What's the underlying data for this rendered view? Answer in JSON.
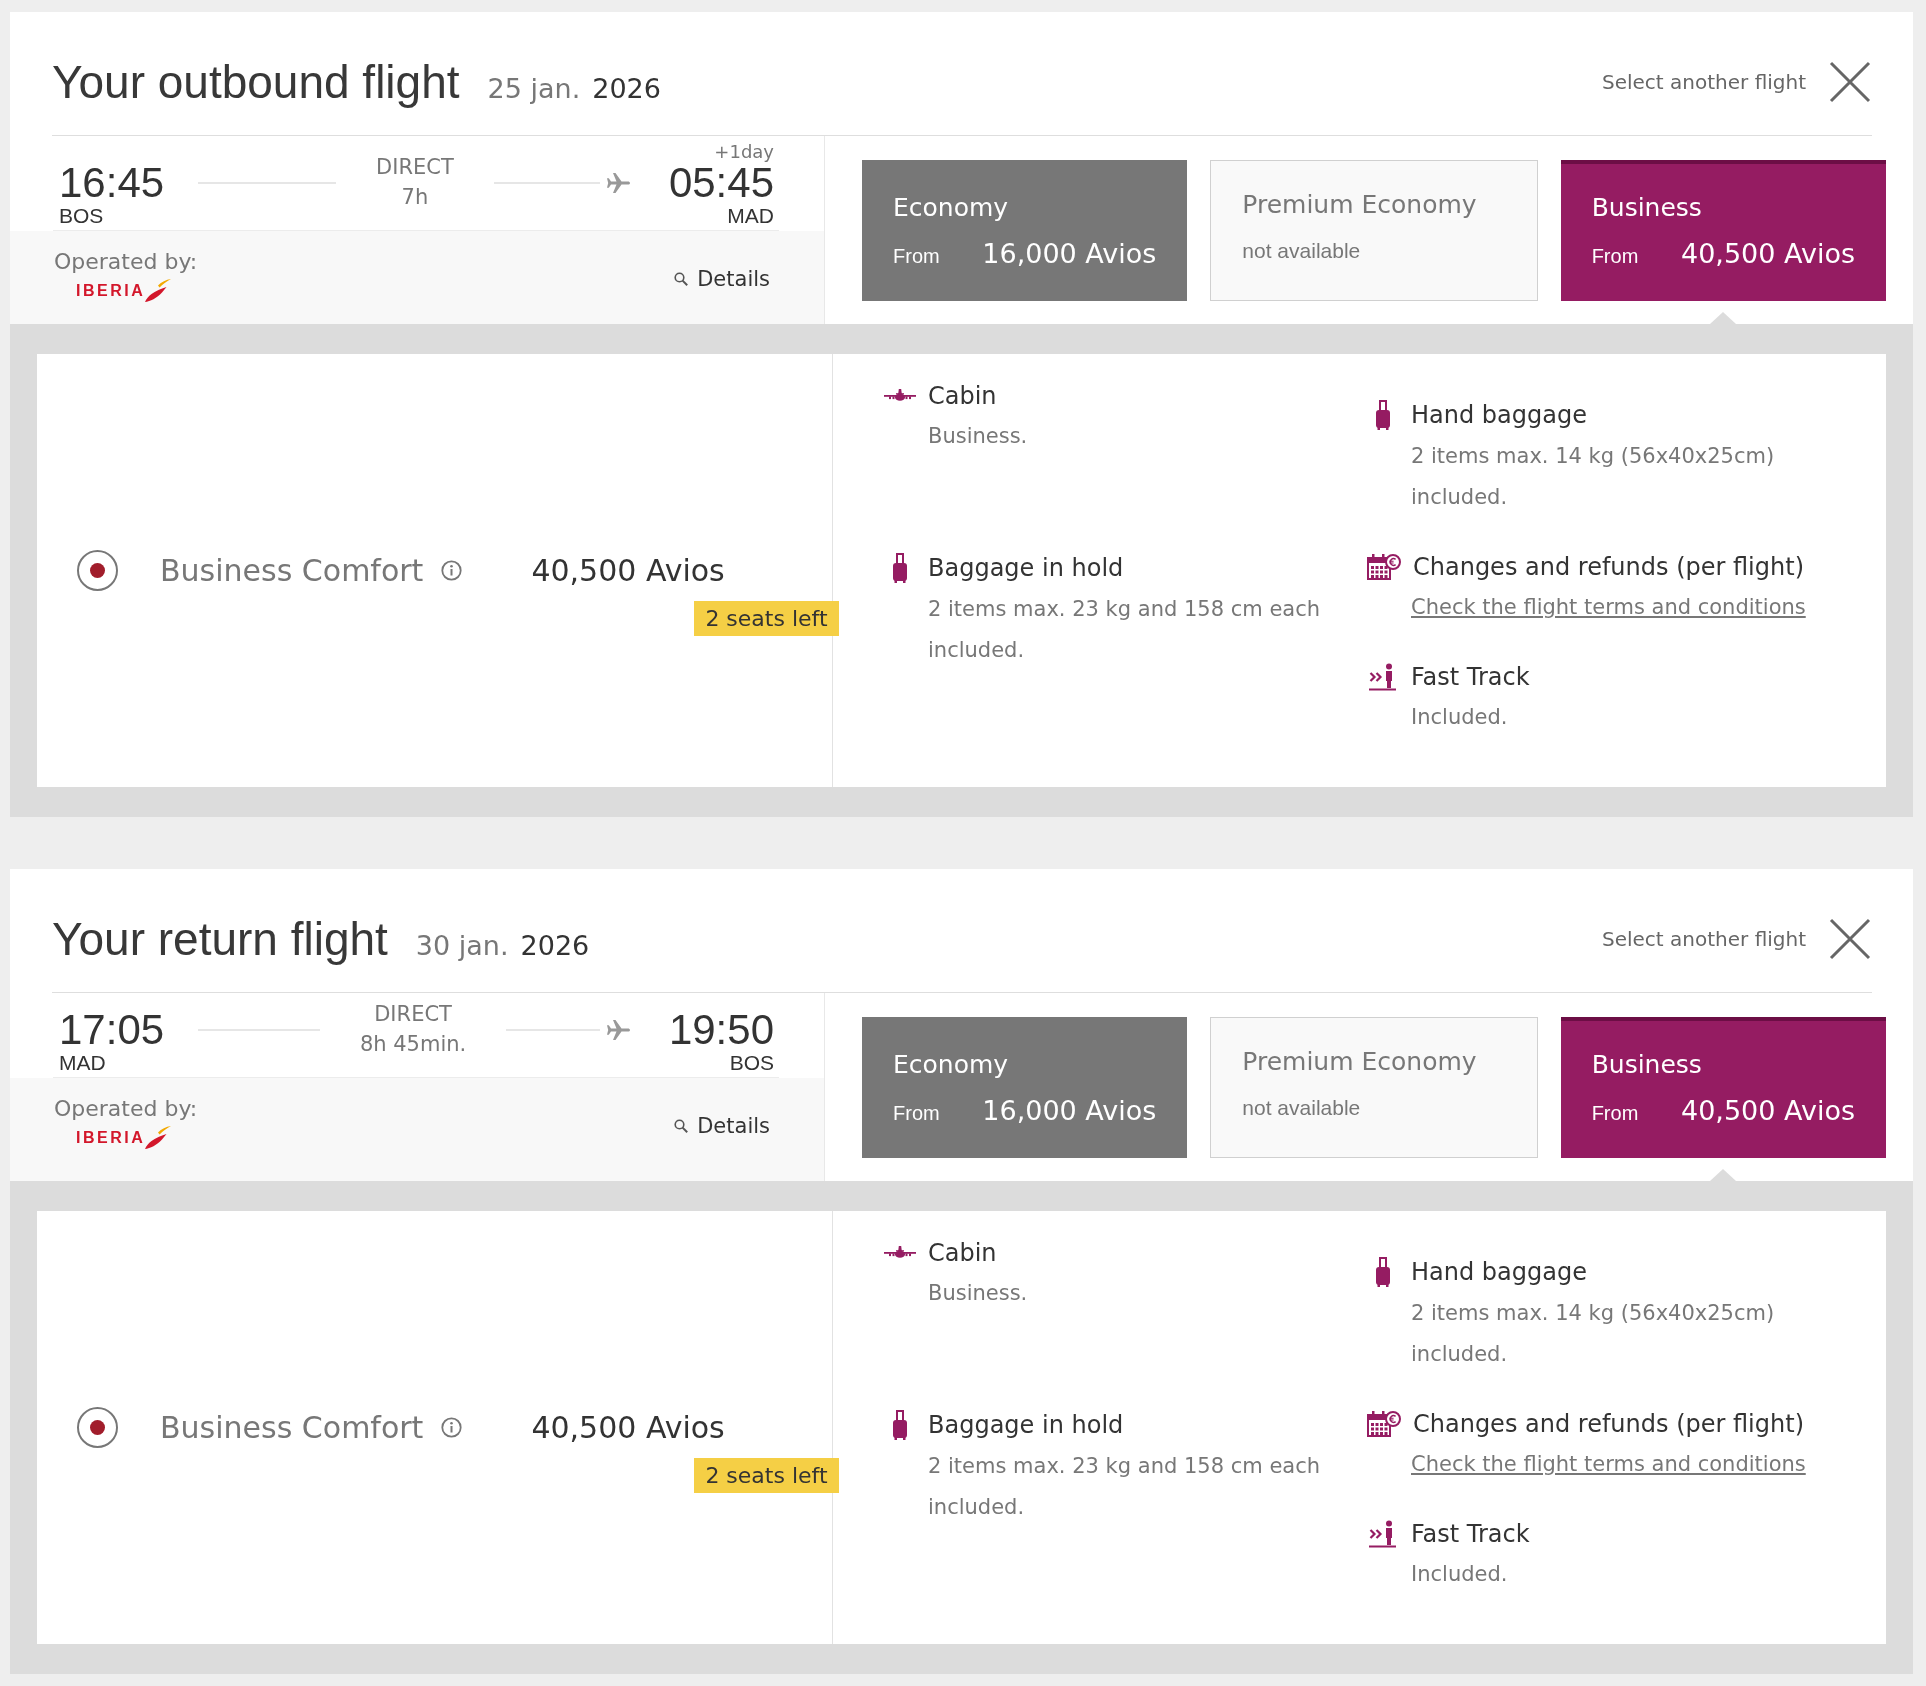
{
  "flights": [
    {
      "heading": "Your outbound flight",
      "date": "25 jan.",
      "year": "2026",
      "change_link": "Select another flight",
      "departure": {
        "time": "16:45",
        "airport": "BOS"
      },
      "stops": "DIRECT",
      "duration": "7h",
      "arrival": {
        "day_offset": "+1day",
        "time": "05:45",
        "airport": "MAD"
      },
      "operated_by": "Operated by:",
      "airline": "IBERIA",
      "details_link": "Details",
      "fares": [
        {
          "cabin": "Economy",
          "available": true,
          "selected": false,
          "from_label": "From",
          "price": "16,000 Avios"
        },
        {
          "cabin": "Premium Economy",
          "available": false,
          "selected": false,
          "note": "not available"
        },
        {
          "cabin": "Business",
          "available": true,
          "selected": true,
          "from_label": "From",
          "price": "40,500 Avios"
        }
      ],
      "options": [
        {
          "name": "Business Comfort",
          "selected": true,
          "price": "40,500 Avios",
          "badge": "2 seats left"
        }
      ],
      "benefits": [
        {
          "kind": "cabin",
          "title": "Cabin",
          "text": "Business."
        },
        {
          "kind": "hand-baggage",
          "title": "Hand baggage",
          "text": "2 items max. 14 kg (56x40x25cm) included."
        },
        {
          "kind": "hold-baggage",
          "title": "Baggage in hold",
          "text": "2 items max. 23 kg and 158 cm each included."
        },
        {
          "kind": "changes",
          "title": "Changes and refunds (per flight)",
          "link": "Check the flight terms and conditions"
        },
        {
          "kind": "fast-track",
          "title": "Fast Track",
          "text": "Included."
        }
      ]
    },
    {
      "heading": "Your return flight",
      "date": "30 jan.",
      "year": "2026",
      "change_link": "Select another flight",
      "departure": {
        "time": "17:05",
        "airport": "MAD"
      },
      "stops": "DIRECT",
      "duration": "8h 45min.",
      "arrival": {
        "time": "19:50",
        "airport": "BOS"
      },
      "operated_by": "Operated by:",
      "airline": "IBERIA",
      "details_link": "Details",
      "fares": [
        {
          "cabin": "Economy",
          "available": true,
          "selected": false,
          "from_label": "From",
          "price": "16,000 Avios"
        },
        {
          "cabin": "Premium Economy",
          "available": false,
          "selected": false,
          "note": "not available"
        },
        {
          "cabin": "Business",
          "available": true,
          "selected": true,
          "from_label": "From",
          "price": "40,500 Avios"
        }
      ],
      "options": [
        {
          "name": "Business Comfort",
          "selected": true,
          "price": "40,500 Avios",
          "badge": "2 seats left"
        }
      ],
      "benefits": [
        {
          "kind": "cabin",
          "title": "Cabin",
          "text": "Business."
        },
        {
          "kind": "hand-baggage",
          "title": "Hand baggage",
          "text": "2 items max. 14 kg (56x40x25cm) included."
        },
        {
          "kind": "hold-baggage",
          "title": "Baggage in hold",
          "text": "2 items max. 23 kg and 158 cm each included."
        },
        {
          "kind": "changes",
          "title": "Changes and refunds (per flight)",
          "link": "Check the flight terms and conditions"
        },
        {
          "kind": "fast-track",
          "title": "Fast Track",
          "text": "Included."
        }
      ]
    }
  ]
}
